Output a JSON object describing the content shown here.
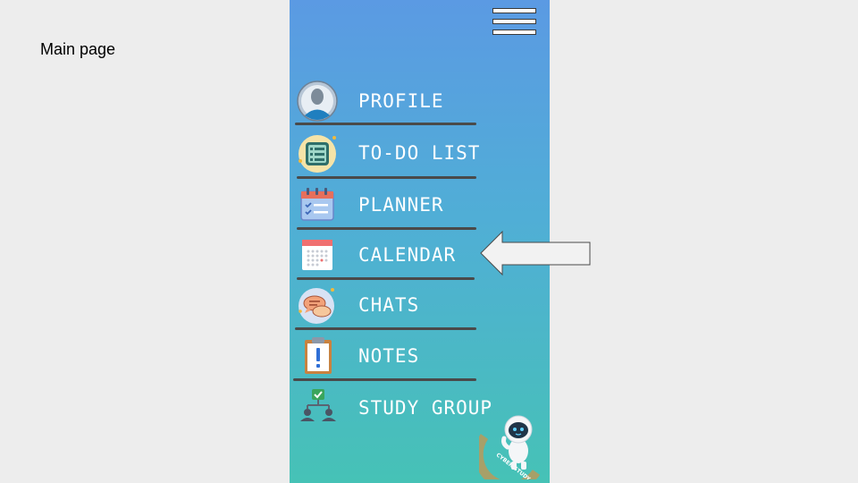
{
  "caption": "Main page",
  "menu": {
    "items": [
      {
        "label": "PROFILE",
        "icon": "profile-icon"
      },
      {
        "label": "TO-DO LIST",
        "icon": "todo-list-icon"
      },
      {
        "label": "PLANNER",
        "icon": "planner-icon"
      },
      {
        "label": "CALENDAR",
        "icon": "calendar-icon"
      },
      {
        "label": "CHATS",
        "icon": "chats-icon"
      },
      {
        "label": "NOTES",
        "icon": "notes-icon"
      },
      {
        "label": "STUDY GROUP",
        "icon": "study-group-icon"
      }
    ]
  },
  "mascot": {
    "text": "CYBER STUDY"
  },
  "colors": {
    "gradient_top": "#5b9ae3",
    "gradient_bottom": "#46c2b6",
    "divider": "#4a4a4a",
    "label": "#ffffff"
  }
}
